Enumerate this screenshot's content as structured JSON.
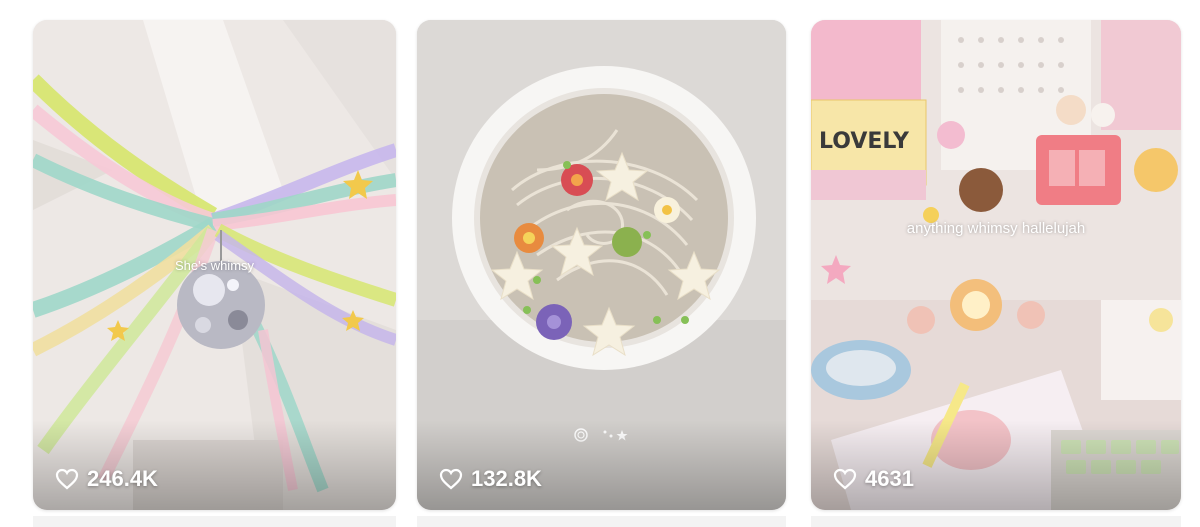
{
  "cards": [
    {
      "overlay_text": "She's whimsy",
      "likes": "246.4K",
      "icon": "heart-outline-icon"
    },
    {
      "overlay_text": "",
      "likes": "132.8K",
      "icon": "heart-outline-icon"
    },
    {
      "overlay_text": "anything whimsy hallelujah",
      "likes": "4631",
      "icon": "heart-outline-icon"
    }
  ],
  "colors": {
    "like_text": "#ffffff",
    "card_bg_1": "#ece7e3",
    "card_bg_2": "#d9d6d3",
    "card_bg_3": "#e9dfdc"
  }
}
